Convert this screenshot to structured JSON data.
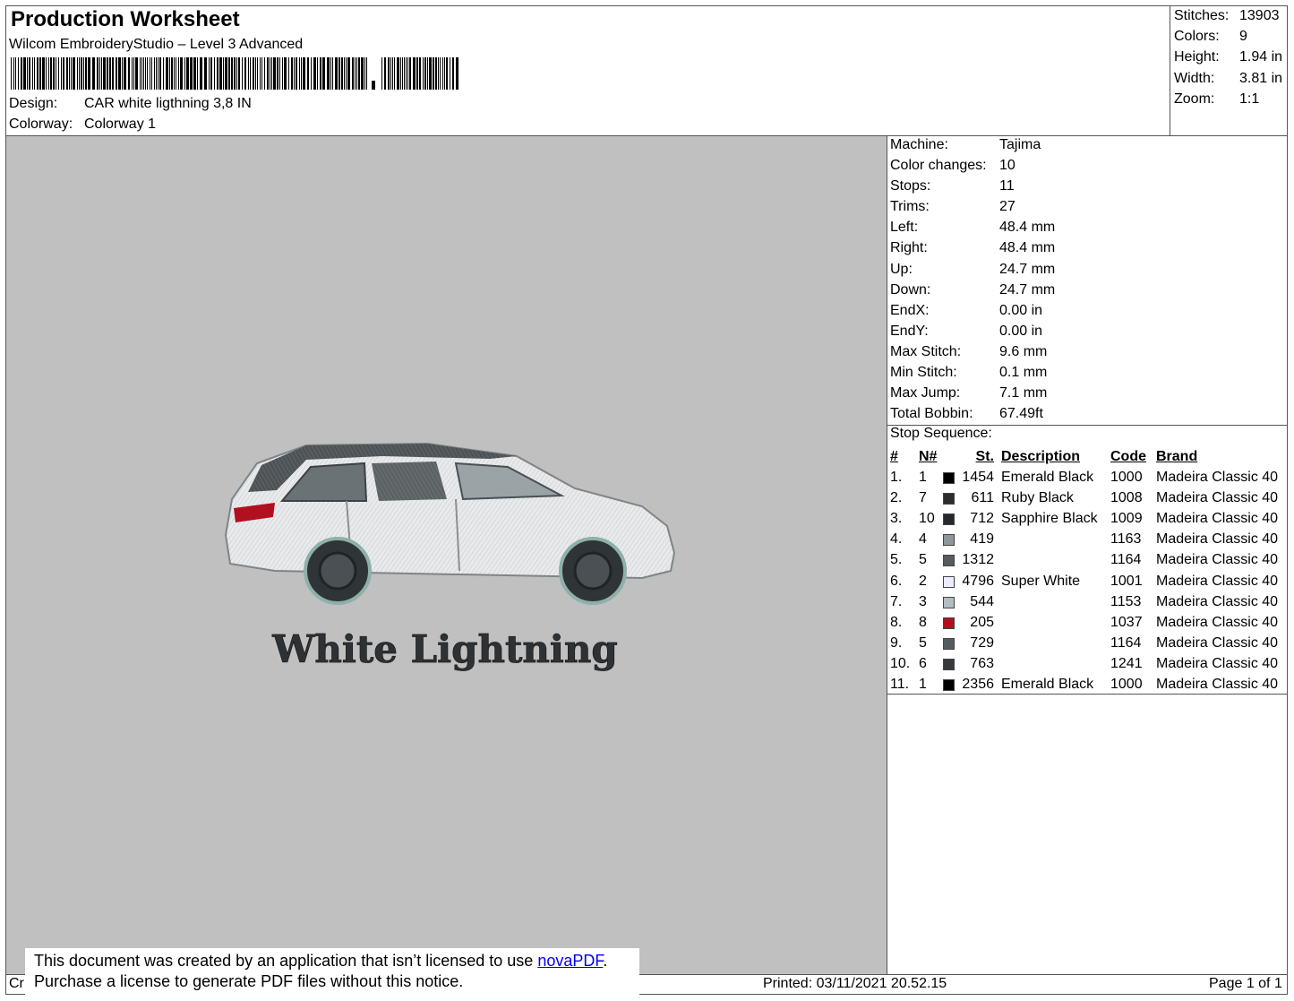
{
  "header": {
    "title": "Production Worksheet",
    "software": "Wilcom EmbroideryStudio – Level 3 Advanced",
    "design_label": "Design:",
    "design_value": "CAR white ligthning 3,8 IN",
    "colorway_label": "Colorway:",
    "colorway_value": "Colorway 1"
  },
  "stats": [
    {
      "label": "Stitches:",
      "value": "13903"
    },
    {
      "label": "Colors:",
      "value": "9"
    },
    {
      "label": "Height:",
      "value": "1.94 in"
    },
    {
      "label": "Width:",
      "value": "3.81 in"
    },
    {
      "label": "Zoom:",
      "value": "1:1"
    }
  ],
  "machine_info": [
    {
      "label": "Machine:",
      "value": "Tajima"
    },
    {
      "label": "Color changes:",
      "value": "10"
    },
    {
      "label": "Stops:",
      "value": "11"
    },
    {
      "label": "Trims:",
      "value": "27"
    },
    {
      "label": "Left:",
      "value": "48.4 mm"
    },
    {
      "label": "Right:",
      "value": "48.4 mm"
    },
    {
      "label": "Up:",
      "value": "24.7 mm"
    },
    {
      "label": "Down:",
      "value": "24.7 mm"
    },
    {
      "label": "EndX:",
      "value": "0.00 in"
    },
    {
      "label": "EndY:",
      "value": "0.00 in"
    },
    {
      "label": "Max Stitch:",
      "value": "9.6 mm"
    },
    {
      "label": "Min Stitch:",
      "value": "0.1 mm"
    },
    {
      "label": "Max Jump:",
      "value": "7.1 mm"
    },
    {
      "label": "Total Bobbin:",
      "value": "67.49ft"
    }
  ],
  "stop_sequence": {
    "title": "Stop Sequence:",
    "headers": {
      "idx": "#",
      "n": "N#",
      "st": "St.",
      "desc": "Description",
      "code": "Code",
      "brand": "Brand"
    },
    "rows": [
      {
        "idx": "1.",
        "n": "1",
        "color": "#000000",
        "st": "1454",
        "desc": "Emerald Black",
        "code": "1000",
        "brand": "Madeira Classic 40"
      },
      {
        "idx": "2.",
        "n": "7",
        "color": "#2a2c2e",
        "st": "611",
        "desc": "Ruby Black",
        "code": "1008",
        "brand": "Madeira Classic 40"
      },
      {
        "idx": "3.",
        "n": "10",
        "color": "#26292b",
        "st": "712",
        "desc": "Sapphire Black",
        "code": "1009",
        "brand": "Madeira Classic 40"
      },
      {
        "idx": "4.",
        "n": "4",
        "color": "#8e9699",
        "st": "419",
        "desc": "",
        "code": "1163",
        "brand": "Madeira Classic 40"
      },
      {
        "idx": "5.",
        "n": "5",
        "color": "#555c60",
        "st": "1312",
        "desc": "",
        "code": "1164",
        "brand": "Madeira Classic 40"
      },
      {
        "idx": "6.",
        "n": "2",
        "color": "#eaedff",
        "st": "4796",
        "desc": "Super White",
        "code": "1001",
        "brand": "Madeira Classic 40"
      },
      {
        "idx": "7.",
        "n": "3",
        "color": "#b3bcc1",
        "st": "544",
        "desc": "",
        "code": "1153",
        "brand": "Madeira Classic 40"
      },
      {
        "idx": "8.",
        "n": "8",
        "color": "#b01020",
        "st": "205",
        "desc": "",
        "code": "1037",
        "brand": "Madeira Classic 40"
      },
      {
        "idx": "9.",
        "n": "5",
        "color": "#555c60",
        "st": "729",
        "desc": "",
        "code": "1164",
        "brand": "Madeira Classic 40"
      },
      {
        "idx": "10.",
        "n": "6",
        "color": "#36393c",
        "st": "763",
        "desc": "",
        "code": "1241",
        "brand": "Madeira Classic 40"
      },
      {
        "idx": "11.",
        "n": "1",
        "color": "#000000",
        "st": "2356",
        "desc": "Emerald Black",
        "code": "1000",
        "brand": "Madeira Classic 40"
      }
    ]
  },
  "design_preview": {
    "text": "White Lightning",
    "background": "#c0c0c0"
  },
  "footer": {
    "left_text": "Cr",
    "notice_line1_prefix": "This document was created by an application that isn’t licensed to use ",
    "notice_link": "novaPDF",
    "notice_line1_suffix": ".",
    "notice_line2": "Purchase a license to generate PDF files without this notice.",
    "printed": "Printed: 03/11/2021 20.52.15",
    "page": "Page 1 of 1"
  }
}
